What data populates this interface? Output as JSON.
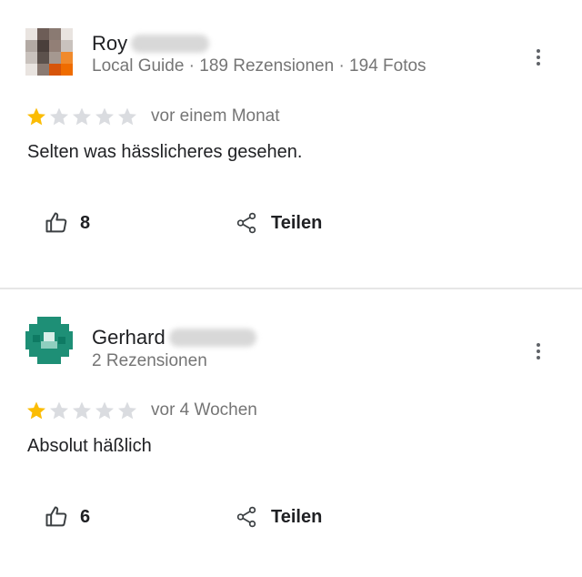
{
  "reviews": [
    {
      "name": "Roy",
      "meta": "Local Guide · 189 Rezensionen · 194 Fotos",
      "rating": 1,
      "time": "vor einem Monat",
      "text": "Selten was hässlicheres gesehen.",
      "likes": "8",
      "share_label": "Teilen",
      "avatar_colors": [
        "#6d5d57",
        "#8a7a72",
        "#b3aaa4",
        "#e9e4e0",
        "#4a3f3b",
        "#927f76",
        "#c9c2bd",
        "#f08a2c",
        "#5c514c",
        "#a59890",
        "#d6540a",
        "#ef6c00"
      ]
    },
    {
      "name": "Gerhard",
      "meta": "2 Rezensionen",
      "rating": 1,
      "time": "vor 4 Wochen",
      "text": "Absolut häßlich",
      "likes": "6",
      "share_label": "Teilen",
      "avatar_colors": [
        "#1e8f76",
        "#0e7a63"
      ]
    }
  ],
  "colors": {
    "star_filled": "#fbbc04",
    "star_empty": "#dadce0",
    "secondary_text": "#757575"
  },
  "icons": [
    "thumb-up-icon",
    "share-icon",
    "more-vert-icon",
    "star-icon"
  ]
}
